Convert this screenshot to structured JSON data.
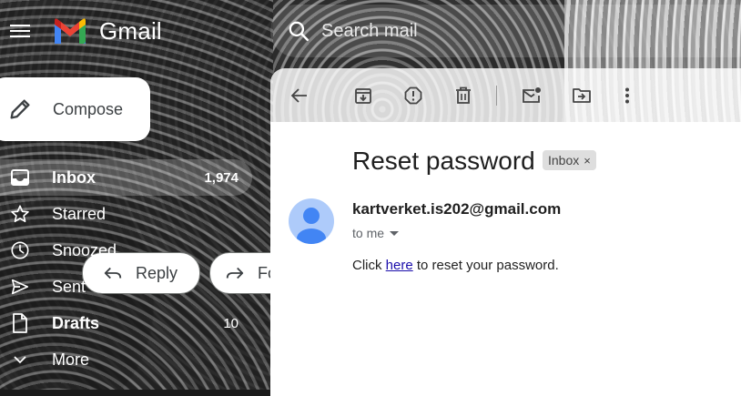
{
  "app": {
    "name": "Gmail"
  },
  "search": {
    "placeholder": "Search mail"
  },
  "sidebar": {
    "compose_label": "Compose",
    "items": [
      {
        "label": "Inbox",
        "count": "1,974",
        "icon": "inbox-icon"
      },
      {
        "label": "Starred",
        "count": "",
        "icon": "star-icon"
      },
      {
        "label": "Snoozed",
        "count": "",
        "icon": "clock-icon"
      },
      {
        "label": "Sent",
        "count": "",
        "icon": "send-icon"
      },
      {
        "label": "Drafts",
        "count": "10",
        "icon": "draft-icon"
      },
      {
        "label": "More",
        "count": "",
        "icon": "chevron-down-icon"
      }
    ]
  },
  "toolbar": {
    "icons": [
      "back-arrow-icon",
      "archive-icon",
      "report-spam-icon",
      "delete-icon",
      "mark-unread-icon",
      "move-to-icon",
      "more-vert-icon"
    ]
  },
  "email": {
    "subject": "Reset password",
    "label": "Inbox",
    "label_remove": "×",
    "sender": "kartverket.is202@gmail.com",
    "recipient": "to me",
    "body_prefix": "Click",
    "body_link": "here",
    "body_suffix": "to reset your password."
  },
  "actions": {
    "reply_label": "Reply",
    "forward_label": "Forward"
  },
  "colors": {
    "gmail_red": "#EA4335",
    "gmail_blue": "#4285F4",
    "gmail_green": "#34A853",
    "gmail_yellow": "#FBBC04",
    "link": "#1a0dab",
    "avatar_bg": "#aecbfa",
    "avatar_fg": "#4285f4"
  }
}
